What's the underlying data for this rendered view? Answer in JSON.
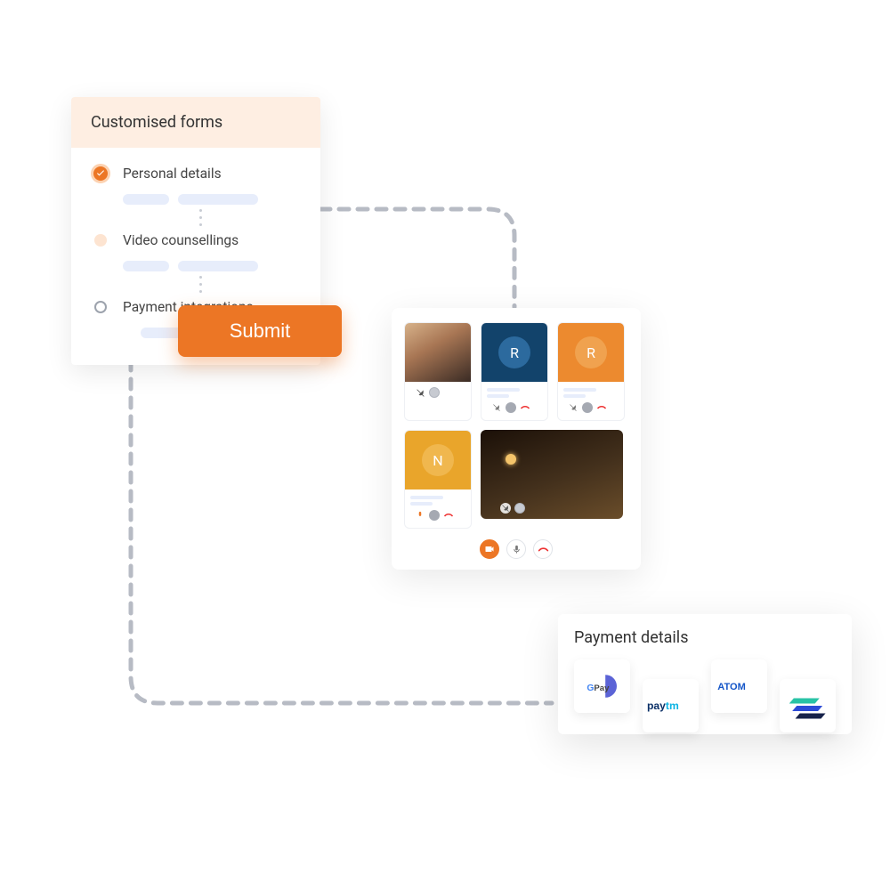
{
  "forms": {
    "title": "Customised forms",
    "steps": [
      {
        "label": "Personal details"
      },
      {
        "label": "Video counsellings"
      },
      {
        "label": "Payment integrations"
      }
    ],
    "submit_label": "Submit"
  },
  "video": {
    "tiles": [
      {
        "kind": "photo1"
      },
      {
        "kind": "avatar",
        "initial": "R",
        "bg": "#12436b",
        "av_bg": "#2c6a9e"
      },
      {
        "kind": "avatar",
        "initial": "R",
        "bg": "#ec8a2f",
        "av_bg": "#f0a24f"
      },
      {
        "kind": "avatar",
        "initial": "N",
        "bg": "#e9a52b",
        "av_bg": "#f0b74e"
      },
      {
        "kind": "photo2"
      }
    ]
  },
  "payment": {
    "title": "Payment details",
    "providers": [
      "gpay",
      "paytm",
      "atom",
      "easebuzz"
    ]
  },
  "colors": {
    "accent": "#ec7625"
  }
}
